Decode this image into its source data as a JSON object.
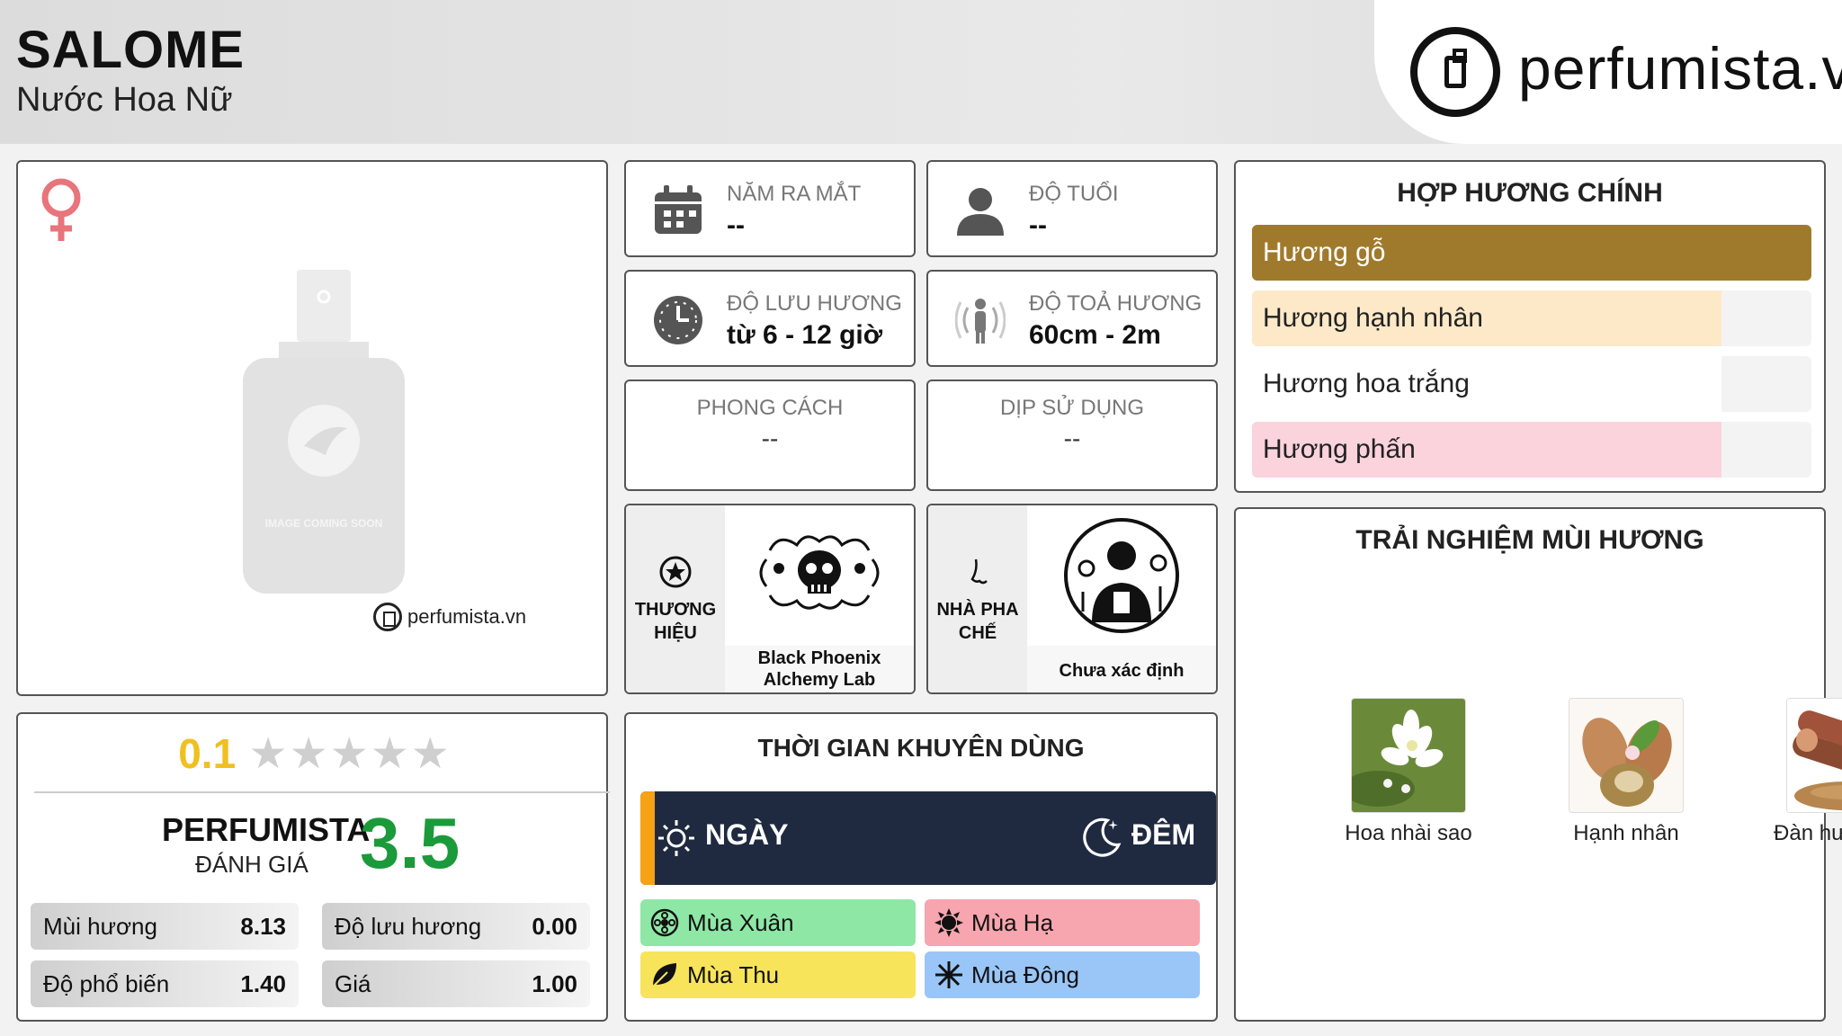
{
  "header": {
    "title": "SALOME",
    "subtitle": "Nước Hoa Nữ",
    "logo_text": "perfumista.vn"
  },
  "product_image": {
    "gender_icon": "venus-icon",
    "placeholder_text": "IMAGE COMING SOON",
    "watermark": "perfumista.vn"
  },
  "rating": {
    "user_score": "0.1",
    "stars_total": 5,
    "perfumista_label_1": "PERFUMISTA",
    "perfumista_label_2": "ĐÁNH GIÁ",
    "perfumista_score": "3.5",
    "metrics": [
      {
        "label": "Mùi hương",
        "value": "8.13"
      },
      {
        "label": "Độ lưu hương",
        "value": "0.00"
      },
      {
        "label": "Độ phổ biến",
        "value": "1.40"
      },
      {
        "label": "Giá",
        "value": "1.00"
      }
    ]
  },
  "info": {
    "release_year": {
      "label": "NĂM RA MẮT",
      "value": "--",
      "icon": "calendar-icon"
    },
    "age": {
      "label": "ĐỘ TUỔI",
      "value": "--",
      "icon": "person-icon"
    },
    "longevity": {
      "label": "ĐỘ LƯU HƯƠNG",
      "value": "từ 6 - 12 giờ",
      "icon": "clock-icon"
    },
    "sillage": {
      "label": "ĐỘ TOẢ HƯƠNG",
      "value": "60cm - 2m",
      "icon": "sillage-icon"
    },
    "style": {
      "label": "PHONG CÁCH",
      "value": "--"
    },
    "occasion": {
      "label": "DỊP SỬ DỤNG",
      "value": "--"
    },
    "brand": {
      "label": "THƯƠNG HIỆU",
      "name": "Black Phoenix Alchemy Lab",
      "icon": "star-circle-icon"
    },
    "perfumer": {
      "label": "NHÀ PHA CHẾ",
      "name": "Chưa xác định",
      "icon": "nose-icon"
    }
  },
  "recommended": {
    "title": "THỜI GIAN KHUYÊN DÙNG",
    "day_label": "NGÀY",
    "night_label": "ĐÊM",
    "seasons": [
      {
        "label": "Mùa Xuân",
        "color": "#8ee7a5",
        "icon": "flower-icon"
      },
      {
        "label": "Mùa Hạ",
        "color": "#f7a5ae",
        "icon": "sun-icon"
      },
      {
        "label": "Mùa Thu",
        "color": "#f7e45a",
        "icon": "leaf-icon"
      },
      {
        "label": "Mùa Đông",
        "color": "#99c6f7",
        "icon": "snowflake-icon"
      }
    ]
  },
  "accords": {
    "title": "HỢP HƯƠNG CHÍNH",
    "items": [
      {
        "label": "Hương gỗ",
        "color": "#a07a2c",
        "fraction": 1.0,
        "text_color": "#ffffff"
      },
      {
        "label": "Hương hạnh nhân",
        "color": "#fde9c8",
        "fraction": 0.84,
        "text_color": "#222222"
      },
      {
        "label": "Hương hoa trắng",
        "color": "#ffffff",
        "fraction": 0.84,
        "text_color": "#222222"
      },
      {
        "label": "Hương phấn",
        "color": "#fbd3dd",
        "fraction": 0.84,
        "text_color": "#222222"
      }
    ]
  },
  "experience": {
    "title": "TRẢI NGHIỆM MÙI HƯƠNG",
    "notes": [
      {
        "name": "Hoa nhài sao"
      },
      {
        "name": "Hạnh nhân"
      },
      {
        "name": "Đàn hương đỏ"
      }
    ]
  }
}
